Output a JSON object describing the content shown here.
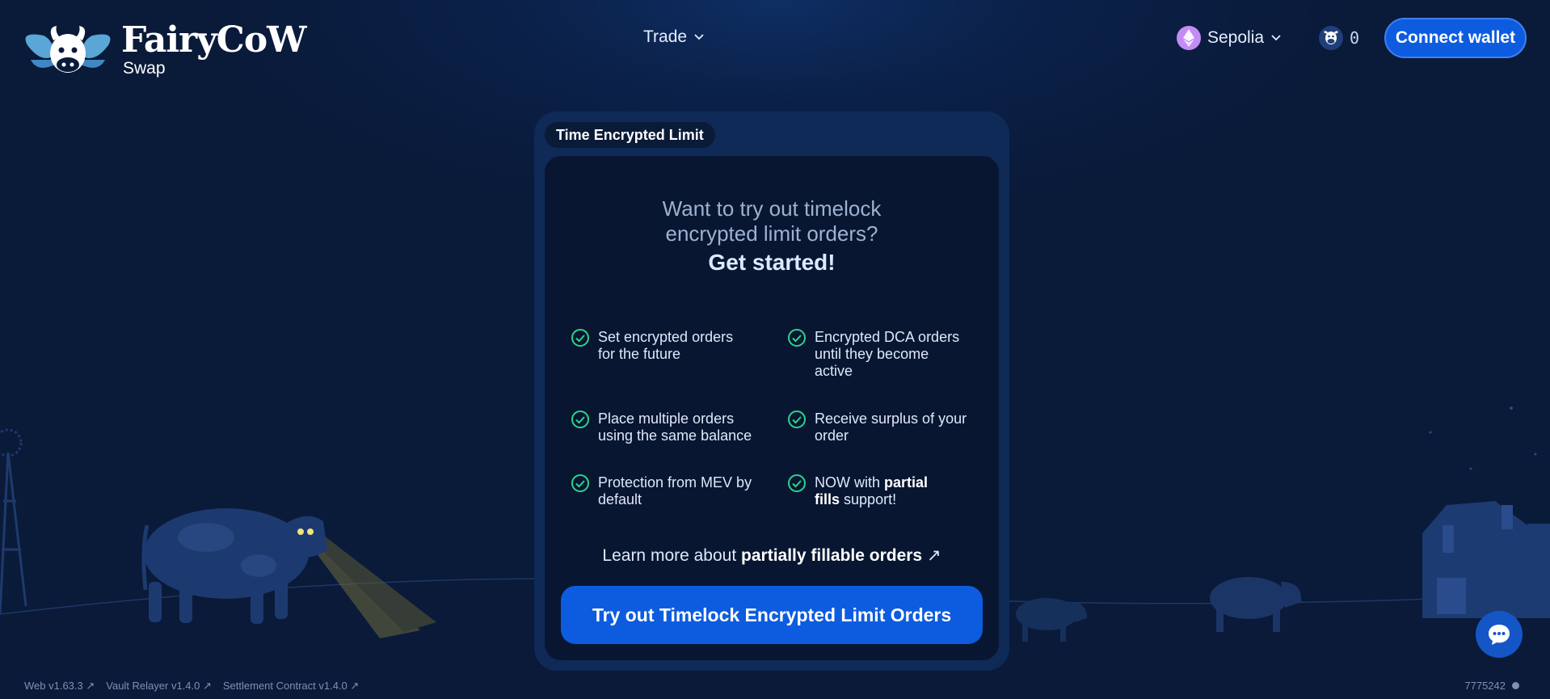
{
  "header": {
    "brand": "FairyCoW",
    "brand_sub": "Swap",
    "trade_label": "Trade",
    "network_label": "Sepolia",
    "cow_count": "0",
    "connect_label": "Connect wallet"
  },
  "card": {
    "tab_label": "Time Encrypted Limit",
    "headline_line1": "Want to try out timelock",
    "headline_line2": "encrypted limit orders?",
    "headline_strong": "Get started!",
    "features": [
      {
        "line1": "Set encrypted orders",
        "line2": "for the future"
      },
      {
        "line1": "Encrypted DCA orders",
        "line2": "until they become",
        "line3": "active"
      },
      {
        "line1": "Place multiple orders",
        "line2": "using the same balance"
      },
      {
        "line1": "Receive surplus of your",
        "line2": "order"
      },
      {
        "line1": "Protection from MEV by",
        "line2": "default"
      },
      {
        "prefix": "NOW with",
        "bold1": "partial",
        "bold2": "fills",
        "suffix": "support!"
      }
    ],
    "learn_prefix": "Learn more about",
    "learn_bold": "partially fillable orders",
    "learn_arrow": "↗",
    "cta_label": "Try out Timelock Encrypted Limit Orders"
  },
  "footer": {
    "links": [
      "Web v1.63.3 ↗",
      "Vault Relayer v1.4.0 ↗",
      "Settlement Contract v1.4.0 ↗"
    ],
    "block_number": "7775242"
  },
  "colors": {
    "accent": "#0d5ce0",
    "check": "#2bd48b",
    "background": "#0a1a39"
  },
  "icons": {
    "trade_chevron": "chevron-down-icon",
    "network": "ethereum-icon",
    "cow_counter": "cow-icon",
    "feature": "check-circle-icon",
    "chat": "chat-bubble-icon"
  }
}
